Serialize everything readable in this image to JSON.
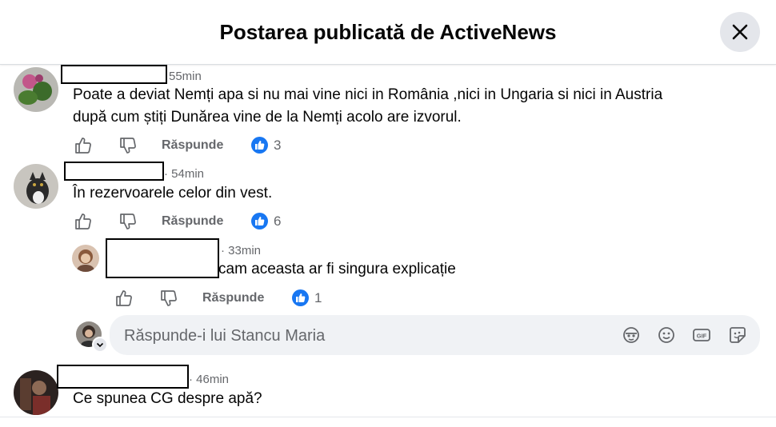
{
  "header": {
    "title": "Postarea publicată de ActiveNews"
  },
  "comments": [
    {
      "time": "55min",
      "text_line1": "Poate a deviat Nemți apa si nu mai vine nici in România ,nici in Ungaria si nici in Austria",
      "text_line2": "după cum știți Dunărea vine de la Nemți acolo are izvorul.",
      "reply_label": "Răspunde",
      "reaction_count": "3"
    },
    {
      "time": "· 54min",
      "text_line1": "În rezervoarele celor din vest.",
      "reply_label": "Răspunde",
      "reaction_count": "6"
    },
    {
      "time": "· 33min",
      "text_line1": "cam aceasta ar fi singura explicație",
      "reply_label": "Răspunde",
      "reaction_count": "1"
    },
    {
      "time": "· 46min",
      "text_line1": "Ce spunea CG despre apă?"
    }
  ],
  "reply_box": {
    "placeholder": "Răspunde-i lui Stancu Maria"
  },
  "icons": {
    "close": "close-icon",
    "like": "thumbs-up-icon",
    "dislike": "thumbs-down-icon",
    "avatar_sticker": "avatar-sticker-icon",
    "emoji": "smile-icon",
    "gif": "gif-icon",
    "sticker": "sticker-icon"
  },
  "colors": {
    "accent": "#1877f2",
    "muted": "#65676b",
    "input_bg": "#f0f2f5"
  }
}
